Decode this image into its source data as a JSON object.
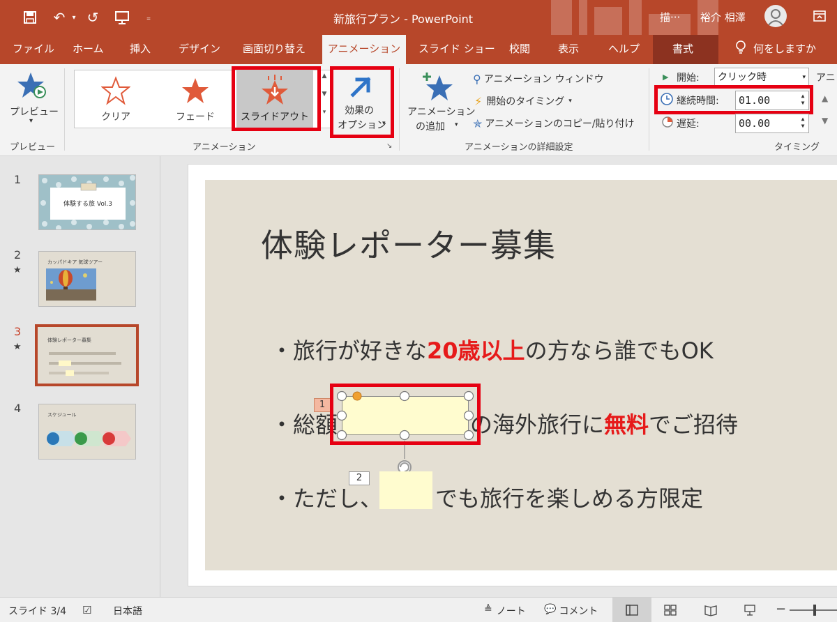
{
  "window": {
    "doc_title": "新旅行プラン - PowerPoint",
    "title_extra": "描···",
    "user_name": "裕介 相澤"
  },
  "tabs": [
    {
      "label": "ファイル"
    },
    {
      "label": "ホーム"
    },
    {
      "label": "挿入"
    },
    {
      "label": "デザイン"
    },
    {
      "label": "画面切り替え"
    },
    {
      "label": "アニメーション",
      "active": true
    },
    {
      "label": "スライド ショー"
    },
    {
      "label": "校閲"
    },
    {
      "label": "表示"
    },
    {
      "label": "ヘルプ"
    },
    {
      "label": "書式"
    }
  ],
  "tell_me": "何をしますか",
  "ribbon": {
    "preview": {
      "button_label": "プレビュー",
      "group_label": "プレビュー"
    },
    "animation": {
      "gallery": [
        "クリア",
        "フェード",
        "スライドアウト"
      ],
      "effect_options_line1": "効果の",
      "effect_options_line2": "オプション",
      "group_label": "アニメーション"
    },
    "advanced": {
      "add_animation_line1": "アニメーション",
      "add_animation_line2": "の追加",
      "animation_pane": "アニメーション ウィンドウ",
      "trigger": "開始のタイミング",
      "painter": "アニメーションのコピー/貼り付け",
      "group_label": "アニメーションの詳細設定"
    },
    "timing": {
      "start_label": "開始:",
      "start_value": "クリック時",
      "duration_label": "継続時間:",
      "duration_value": "01.00",
      "delay_label": "遅延:",
      "delay_value": "00.00",
      "group_label": "タイミング",
      "cut_label": "アニ"
    }
  },
  "thumbnails": [
    {
      "num": "1",
      "star": "",
      "text": "体験する旅 Vol.3"
    },
    {
      "num": "2",
      "star": "★",
      "text": "カッパドキア 気球ツアー"
    },
    {
      "num": "3",
      "star": "★",
      "text": "体験レポーター募集",
      "active": true
    },
    {
      "num": "4",
      "star": "",
      "text": "スケジュール"
    }
  ],
  "slide": {
    "title": "体験レポーター募集",
    "bullet_mark": "・",
    "line1_pre": "旅行が好きな",
    "line1_hl": "20歳以上",
    "line1_post": "の方なら誰でもOK",
    "line2_pre": "総額",
    "line2_post": "の海外旅行に",
    "line2_hl": "無料",
    "line2_post2": "でご招待",
    "line3_pre": "ただし、",
    "line3_post": "でも旅行を楽しめる方限定",
    "anim_tag_1": "1",
    "anim_tag_2": "2"
  },
  "status": {
    "slide_info": "スライド 3/4",
    "language": "日本語",
    "notes": "ノート",
    "comments": "コメント"
  },
  "colors": {
    "accent": "#b7472a",
    "highlight_red": "#e61a1a",
    "annotation_box": "#e60012"
  }
}
